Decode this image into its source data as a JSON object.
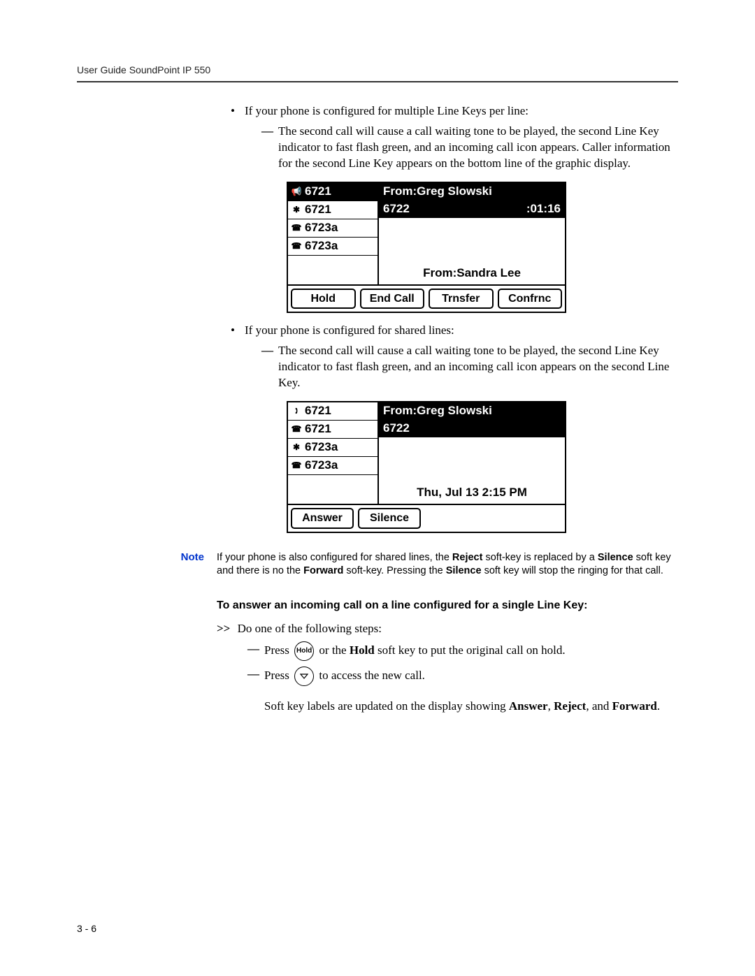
{
  "header": {
    "title": "User Guide SoundPoint IP 550"
  },
  "bullets": {
    "b1": "If your phone is configured for multiple Line Keys per line:",
    "b1_sub": "The second call will cause a call waiting tone to be played, the second Line Key indicator to fast flash green, and an incoming call icon appears. Caller information for the second Line Key appears on the bottom line of the graphic display.",
    "b2": "If your phone is configured for shared lines:",
    "b2_sub": "The second call will cause a call waiting tone to be played, the second Line Key indicator to fast flash green, and an incoming call icon appears on the second Line Key."
  },
  "screen1": {
    "lines": [
      "6721",
      "6721",
      "6723a",
      "6723a"
    ],
    "from": "From:Greg Slowski",
    "number": "6722",
    "timer": ":01:16",
    "caller": "From:Sandra Lee",
    "softkeys": [
      "Hold",
      "End Call",
      "Trnsfer",
      "Confrnc"
    ]
  },
  "screen2": {
    "lines": [
      "6721",
      "6721",
      "6723a",
      "6723a"
    ],
    "from": "From:Greg Slowski",
    "number": "6722",
    "datetime": "Thu, Jul 13  2:15 PM",
    "softkeys": [
      "Answer",
      "Silence"
    ]
  },
  "note": {
    "label": "Note",
    "text_before": "If your phone is also configured for shared lines, the ",
    "reject": "Reject",
    "text_mid1": " soft-key is replaced by a ",
    "silence": "Silence",
    "text_mid2": " soft key and there is no the ",
    "forward": "Forward",
    "text_mid3": " soft-key. Pressing the ",
    "silence2": "Silence",
    "text_after": " soft key will stop the ringing for that call."
  },
  "subheading": "To answer an incoming call on a line configured for a single Line Key:",
  "steps": {
    "intro_prefix": ">>",
    "intro": "Do one of the following steps:",
    "s1_before": "Press ",
    "s1_btn": "Hold",
    "s1_mid": " or the ",
    "s1_bold": "Hold",
    "s1_after": " soft key to put the original call on hold.",
    "s2_before": "Press  ",
    "s2_after": " to access the new call.",
    "s3_before": "Soft key labels are updated on the display showing ",
    "s3_answer": "Answer",
    "s3_sep1": ", ",
    "s3_reject": "Reject",
    "s3_sep2": ", and ",
    "s3_forward": "Forward",
    "s3_after": "."
  },
  "footer": {
    "page": "3 - 6"
  }
}
